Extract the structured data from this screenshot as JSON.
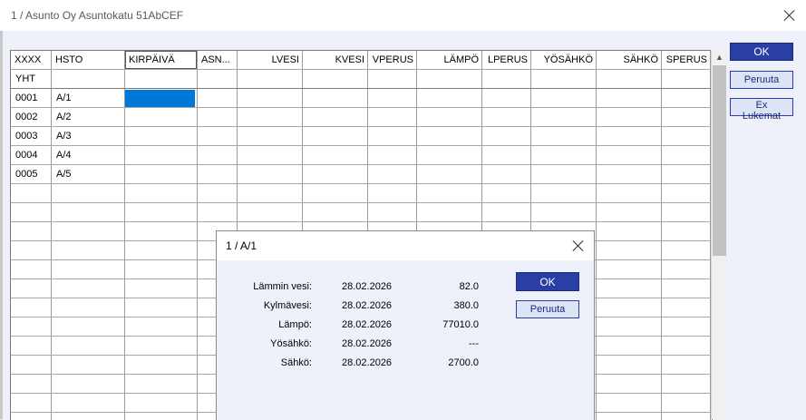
{
  "window": {
    "title": "1 / Asunto Oy Asuntokatu 51AbCEF"
  },
  "grid": {
    "headers": [
      "XXXX",
      "HSTO",
      "KIRPÄIVÄ",
      "ASN...",
      "LVESI",
      "KVESI",
      "VPERUS",
      "LÄMPÖ",
      "LPERUS",
      "YÖSÄHKÖ",
      "SÄHKÖ",
      "SPERUS"
    ],
    "total_label": "YHT",
    "rows": [
      {
        "id": "0001",
        "hsto": "A/1"
      },
      {
        "id": "0002",
        "hsto": "A/2"
      },
      {
        "id": "0003",
        "hsto": "A/3"
      },
      {
        "id": "0004",
        "hsto": "A/4"
      },
      {
        "id": "0005",
        "hsto": "A/5"
      }
    ]
  },
  "buttons": {
    "ok": "OK",
    "peruuta": "Peruuta",
    "ex_lukemat": "Ex Lukemat"
  },
  "dialog": {
    "title": "1 / A/1",
    "ok": "OK",
    "cancel": "Peruuta",
    "readings": [
      {
        "label": "Lämmin vesi:",
        "date": "28.02.2026",
        "value": "82.0"
      },
      {
        "label": "Kylmävesi:",
        "date": "28.02.2026",
        "value": "380.0"
      },
      {
        "label": "Lämpö:",
        "date": "28.02.2026",
        "value": "77010.0"
      },
      {
        "label": "Yösähkö:",
        "date": "28.02.2026",
        "value": "---"
      },
      {
        "label": "Sähkö:",
        "date": "28.02.2026",
        "value": "2700.0"
      }
    ]
  },
  "colors": {
    "accent": "#2a3fa5",
    "selection": "#0078d7",
    "background": "#eef0fa"
  }
}
